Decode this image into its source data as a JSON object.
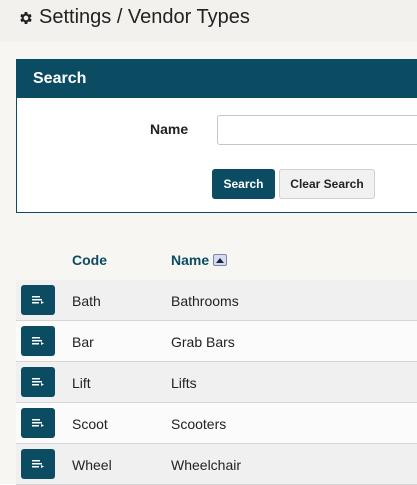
{
  "page": {
    "title": "Settings / Vendor Types"
  },
  "search": {
    "header": "Search",
    "name_label": "Name",
    "name_value": "",
    "search_button": "Search",
    "clear_button": "Clear Search"
  },
  "table": {
    "columns": {
      "code": "Code",
      "name": "Name"
    },
    "sort": {
      "column": "name",
      "direction": "ascending"
    },
    "rows": [
      {
        "code": "Bath",
        "name": "Bathrooms"
      },
      {
        "code": "Bar",
        "name": "Grab Bars"
      },
      {
        "code": "Lift",
        "name": "Lifts"
      },
      {
        "code": "Scoot",
        "name": "Scooters"
      },
      {
        "code": "Wheel",
        "name": "Wheelchair"
      }
    ]
  },
  "colors": {
    "accent": "#0b4c63",
    "page_background": "#f7f6f3"
  },
  "icons": {
    "title": "gear-icon",
    "row_action": "edit-list-icon",
    "sort": "sort-ascending-icon"
  }
}
